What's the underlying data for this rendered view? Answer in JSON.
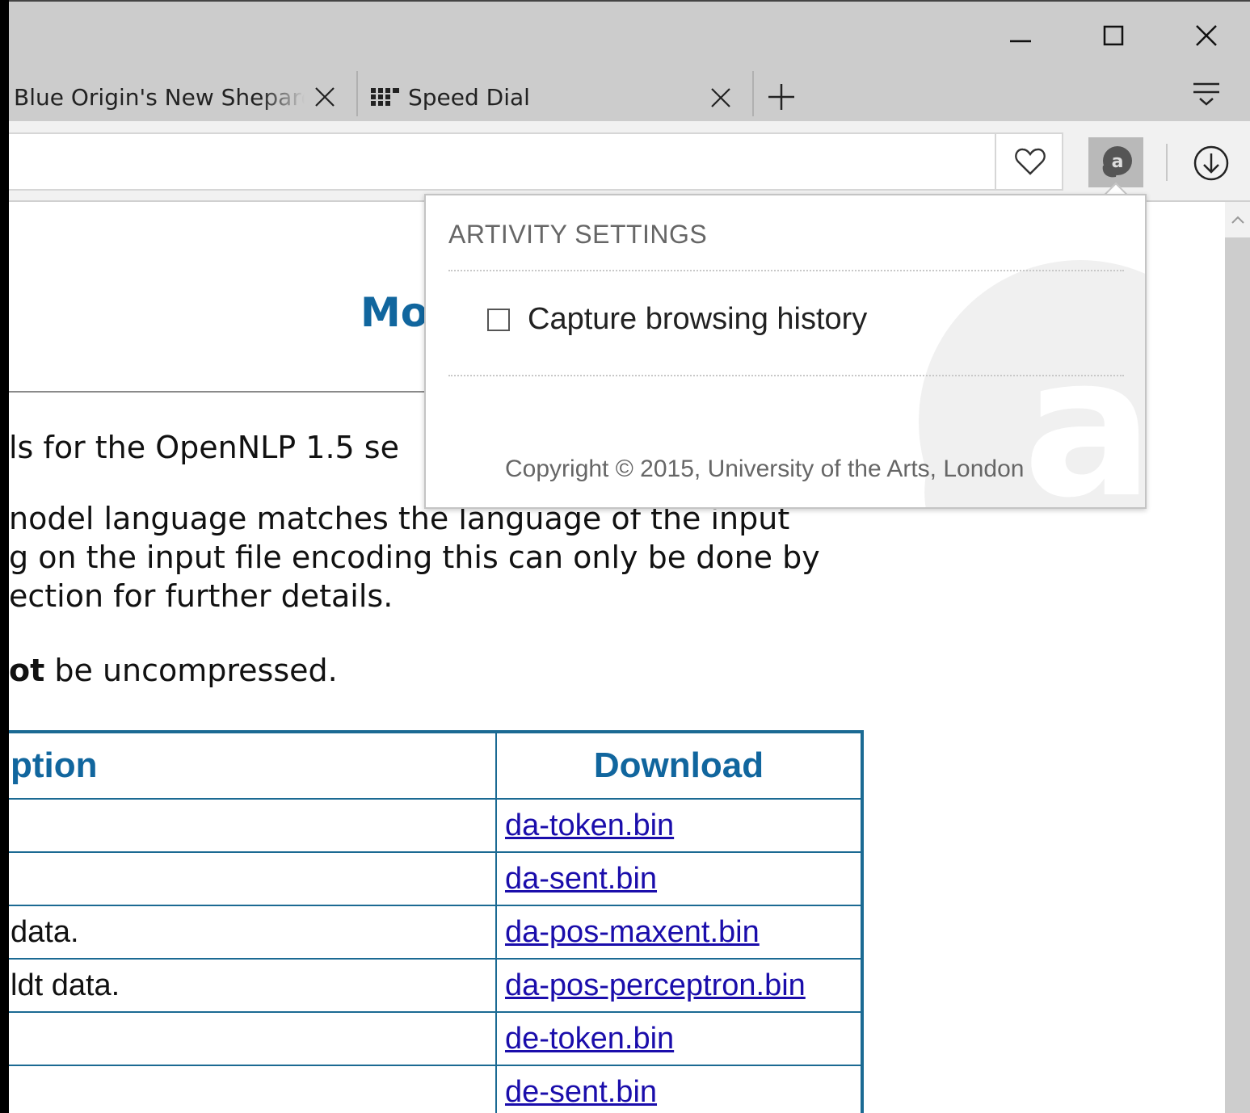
{
  "tabs": [
    {
      "title": "Blue Origin's New Shepard",
      "close_glyph": "✕"
    },
    {
      "title": "Speed Dial",
      "close_glyph": "✕"
    }
  ],
  "new_tab_glyph": "+",
  "page": {
    "heading_fragment": "Mo",
    "paragraphs": [
      "ls for the OpenNLP 1.5 se",
      "nodel language matches the language of the input",
      "g on the input file encoding this can only be done by",
      "ection for further details."
    ],
    "note_bold": "ot",
    "note_rest": " be uncompressed.",
    "table": {
      "headers": [
        "ption",
        "Download"
      ],
      "rows": [
        {
          "desc": "",
          "file": "da-token.bin"
        },
        {
          "desc": "",
          "file": "da-sent.bin"
        },
        {
          "desc": "data.",
          "file": "da-pos-maxent.bin"
        },
        {
          "desc": "ldt data.",
          "file": "da-pos-perceptron.bin"
        },
        {
          "desc": "",
          "file": "de-token.bin"
        },
        {
          "desc": "",
          "file": "de-sent.bin"
        }
      ]
    }
  },
  "popup": {
    "title": "ARTIVITY SETTINGS",
    "capture_label": "Capture browsing history",
    "capture_checked": false,
    "copyright": "Copyright © 2015, University of the Arts, London"
  },
  "colors": {
    "heading": "#11669e",
    "link": "#1a0dab",
    "table_border": "#1b6a93"
  }
}
